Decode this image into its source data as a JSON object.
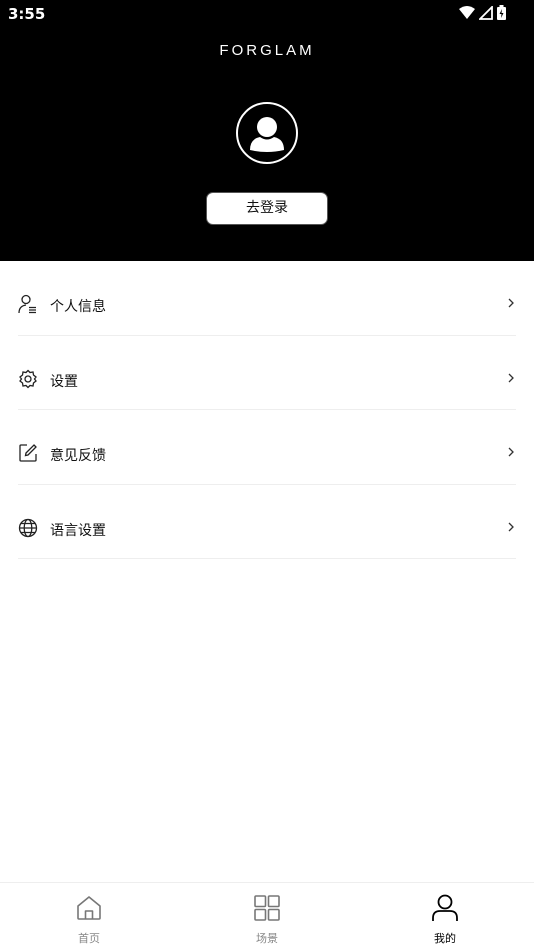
{
  "status_bar": {
    "time": "3:55"
  },
  "header": {
    "brand": "FORGLAM",
    "login_button": "去登录"
  },
  "menu": [
    {
      "label": "个人信息",
      "icon": "user-list-icon"
    },
    {
      "label": "设置",
      "icon": "gear-icon"
    },
    {
      "label": "意见反馈",
      "icon": "edit-icon"
    },
    {
      "label": "语言设置",
      "icon": "globe-icon"
    }
  ],
  "bottom_nav": [
    {
      "label": "首页",
      "icon": "home-icon",
      "active": false
    },
    {
      "label": "场景",
      "icon": "grid-icon",
      "active": false
    },
    {
      "label": "我的",
      "icon": "user-icon",
      "active": true
    }
  ],
  "colors": {
    "header_bg": "#000000",
    "active_tab": "#000000",
    "inactive_tab": "#888888"
  }
}
